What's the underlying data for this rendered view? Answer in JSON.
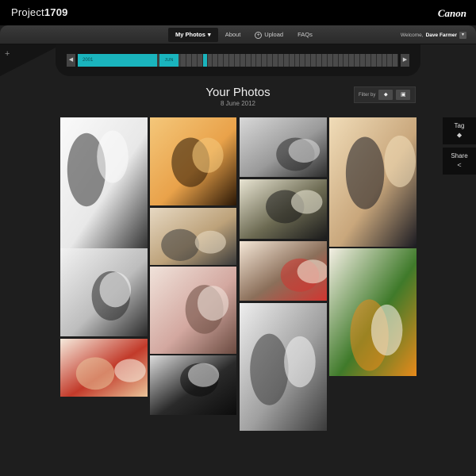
{
  "header": {
    "brand_prefix": "Project",
    "brand_number": "1709",
    "logo_text": "Canon"
  },
  "nav": {
    "items": [
      {
        "label": "My Photos",
        "active": true
      },
      {
        "label": "About"
      },
      {
        "label": "Upload",
        "icon": "plus-circle-icon"
      },
      {
        "label": "FAQs"
      }
    ],
    "dropdown_glyph": "▾",
    "welcome_prefix": "Welcome,",
    "user_name": "Dave Farmer"
  },
  "timeline": {
    "year": "2001",
    "month": "JUN"
  },
  "page": {
    "title": "Your Photos",
    "date": "8 June 2012",
    "filter_label": "Filter by",
    "filter_options": [
      "tag-icon",
      "camera-icon"
    ]
  },
  "side_actions": [
    {
      "label": "Tag",
      "icon": "tag-icon"
    },
    {
      "label": "Share",
      "icon": "share-icon"
    }
  ],
  "photos": [
    {
      "name": "wedding-car-bow",
      "colors": [
        "#e8e8e8",
        "#333",
        "#fafafa"
      ]
    },
    {
      "name": "couple-silhouette-sunset",
      "colors": [
        "#e9a24a",
        "#2a1706",
        "#f4c77a"
      ]
    },
    {
      "name": "church-aisle",
      "colors": [
        "#9a9a9a",
        "#2c2c2c",
        "#d8d8d8"
      ]
    },
    {
      "name": "bride-groom-laughing",
      "colors": [
        "#c9a77c",
        "#1b1b22",
        "#f0dcb8"
      ]
    },
    {
      "name": "bridesmaids-dresses",
      "colors": [
        "#bdbdbd",
        "#2a2a2a",
        "#f2f2f2"
      ]
    },
    {
      "name": "older-couple",
      "colors": [
        "#bda27a",
        "#3a3a3a",
        "#e6d8c2"
      ]
    },
    {
      "name": "cake-cutting",
      "colors": [
        "#6c6a52",
        "#1b1b1b",
        "#e8e4d2"
      ]
    },
    {
      "name": "bridesmaids-smiling",
      "colors": [
        "#8b6f5a",
        "#d23530",
        "#f4e6d6"
      ]
    },
    {
      "name": "flower-girl-garden",
      "colors": [
        "#3f7a2a",
        "#e88a1b",
        "#f4efe4"
      ]
    },
    {
      "name": "rings-hands-bouquet",
      "colors": [
        "#d3a8a0",
        "#6a4a40",
        "#f0e2da"
      ]
    },
    {
      "name": "bride-makeup",
      "colors": [
        "#c23a2a",
        "#e9c49a",
        "#f6eadc"
      ]
    },
    {
      "name": "groom-cufflinks",
      "colors": [
        "#2a2a2a",
        "#0c0c0c",
        "#dcdcdc"
      ]
    },
    {
      "name": "wedding-dress-detail",
      "colors": [
        "#a0a0a0",
        "#3a3a3a",
        "#eeeeee"
      ]
    }
  ]
}
